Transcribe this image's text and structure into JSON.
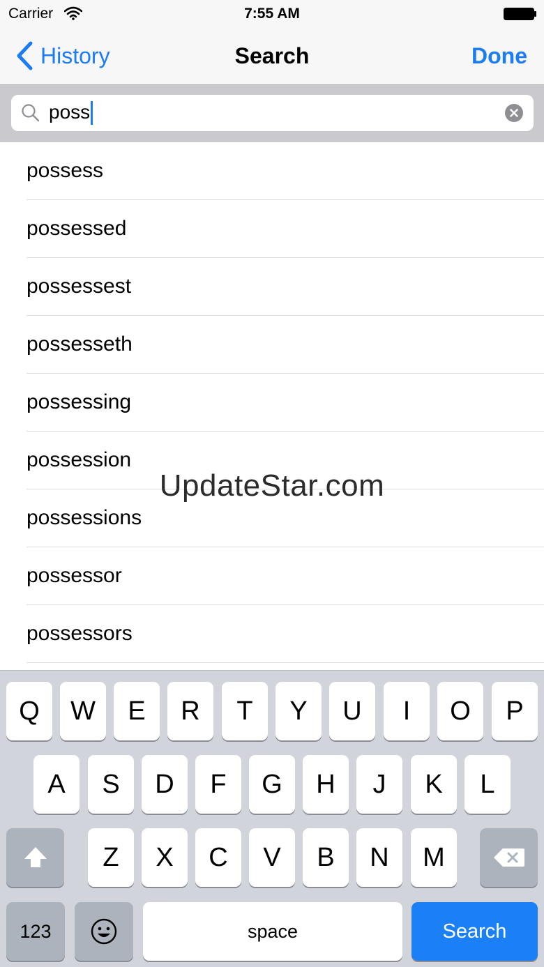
{
  "status_bar": {
    "carrier": "Carrier",
    "time": "7:55 AM"
  },
  "nav": {
    "back_label": "History",
    "title": "Search",
    "done_label": "Done"
  },
  "search": {
    "query": "poss"
  },
  "results": [
    "possess",
    "possessed",
    "possessest",
    "possesseth",
    "possessing",
    "possession",
    "possessions",
    "possessor",
    "possessors"
  ],
  "watermark": "UpdateStar.com",
  "keyboard": {
    "row1": [
      "Q",
      "W",
      "E",
      "R",
      "T",
      "Y",
      "U",
      "I",
      "O",
      "P"
    ],
    "row2": [
      "A",
      "S",
      "D",
      "F",
      "G",
      "H",
      "J",
      "K",
      "L"
    ],
    "row3": [
      "Z",
      "X",
      "C",
      "V",
      "B",
      "N",
      "M"
    ],
    "numbers_label": "123",
    "space_label": "space",
    "search_label": "Search",
    "shift_icon": "shift-arrow",
    "delete_icon": "backspace",
    "emoji_icon": "smiley-face"
  },
  "colors": {
    "accent": "#1b7cf4",
    "keyboard_bg": "#d1d5db",
    "search_key": "#1b80f6"
  }
}
